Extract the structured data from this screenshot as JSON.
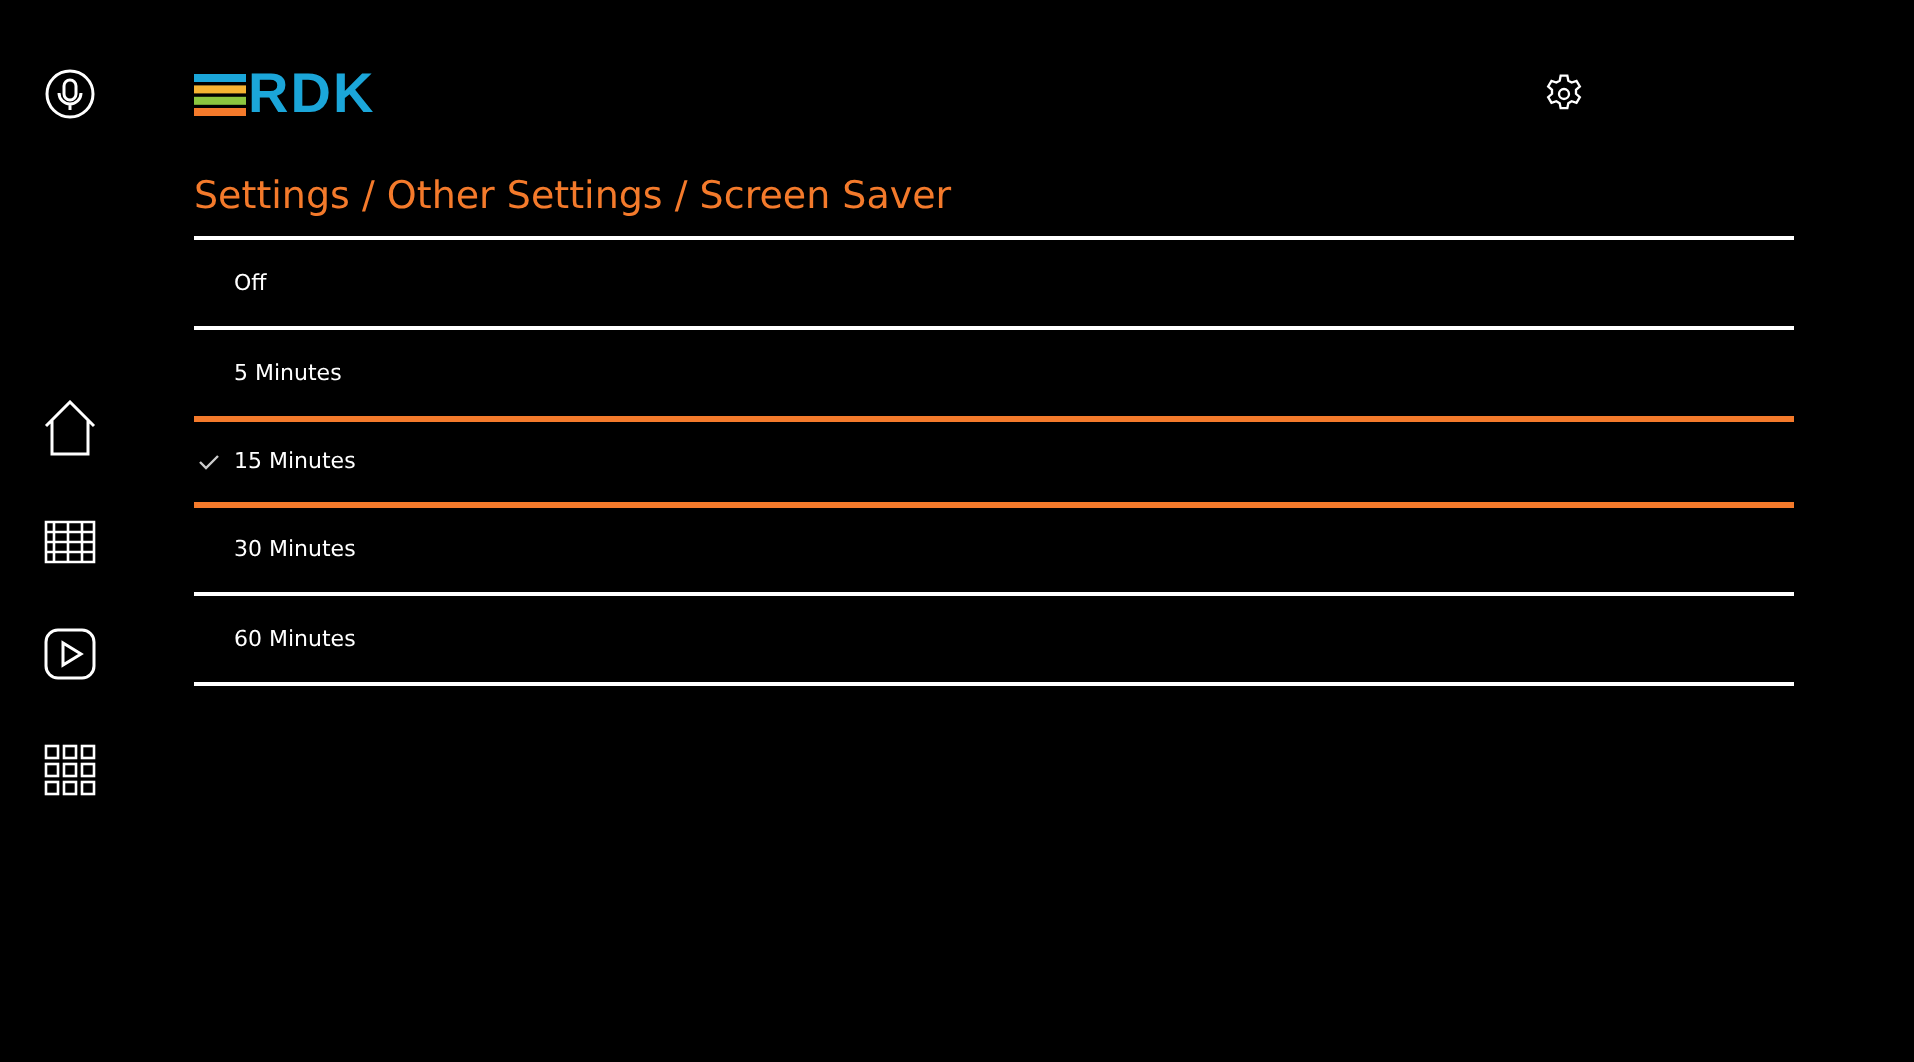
{
  "logo": {
    "text": "RDK"
  },
  "breadcrumb": "Settings / Other Settings / Screen Saver",
  "options": [
    {
      "label": "Off",
      "checked": false,
      "focused": false
    },
    {
      "label": "5 Minutes",
      "checked": false,
      "focused": false
    },
    {
      "label": "15 Minutes",
      "checked": true,
      "focused": true
    },
    {
      "label": "30 Minutes",
      "checked": false,
      "focused": false
    },
    {
      "label": "60 Minutes",
      "checked": false,
      "focused": false
    }
  ]
}
